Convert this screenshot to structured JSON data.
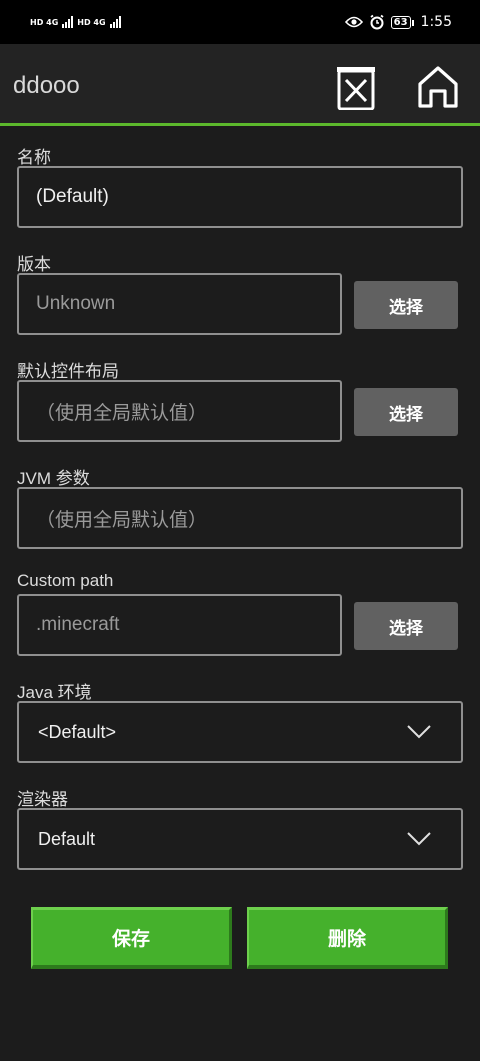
{
  "status_bar": {
    "network_1": "HD 4G",
    "network_2": "HD 4G",
    "battery": "63",
    "time": "1:55"
  },
  "app_bar": {
    "title": "ddooo",
    "delete_icon": "trash-x-icon",
    "home_icon": "home-icon"
  },
  "form": {
    "name": {
      "label": "名称",
      "value": "(Default)"
    },
    "version": {
      "label": "版本",
      "placeholder": "Unknown",
      "button": "选择"
    },
    "control_layout": {
      "label": "默认控件布局",
      "placeholder": "（使用全局默认值）",
      "button": "选择"
    },
    "jvm_args": {
      "label": "JVM 参数",
      "placeholder": "（使用全局默认值）"
    },
    "custom_path": {
      "label": "Custom path",
      "placeholder": ".minecraft",
      "button": "选择"
    },
    "java_env": {
      "label": "Java 环境",
      "value": "<Default>"
    },
    "renderer": {
      "label": "渲染器",
      "value": "Default"
    }
  },
  "actions": {
    "save": "保存",
    "delete": "删除"
  },
  "colors": {
    "accent": "#5cb82c",
    "button_green": "#45b12c",
    "pick_button": "#616161",
    "background": "#1c1c1c"
  }
}
